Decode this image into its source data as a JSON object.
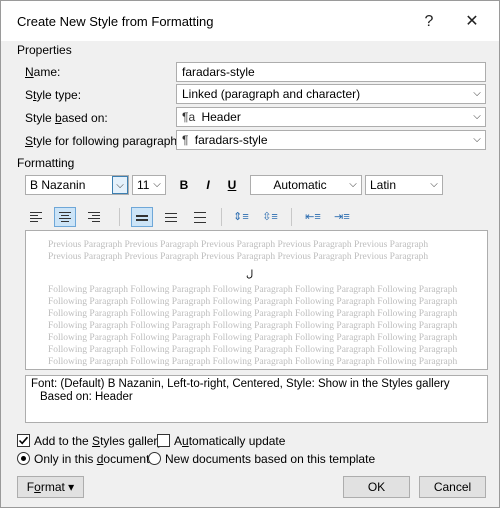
{
  "window": {
    "title": "Create New Style from Formatting",
    "help": "?",
    "close": "✕"
  },
  "properties": {
    "section_label": "Properties",
    "name_label_u": "N",
    "name_label_rest": "ame:",
    "name_value": "faradars-style",
    "type_label_pre": "S",
    "type_label_u": "t",
    "type_label_rest": "yle type:",
    "type_value": "Linked (paragraph and character)",
    "based_label_pre": "Style ",
    "based_label_u": "b",
    "based_label_rest": "ased on:",
    "based_icon": "¶a",
    "based_value": "Header",
    "following_label_u": "S",
    "following_label_rest": "tyle for following paragraph:",
    "following_icon": "¶",
    "following_value": "faradars-style"
  },
  "formatting": {
    "section_label": "Formatting",
    "font": "B Nazanin",
    "size": "11",
    "bold": "B",
    "italic": "I",
    "underline": "U",
    "color": "Automatic",
    "script": "Latin"
  },
  "preview": {
    "previous_text": "Previous Paragraph Previous Paragraph Previous Paragraph Previous Paragraph Previous Paragraph Previous Paragraph Previous Paragraph Previous Paragraph Previous Paragraph Previous Paragraph",
    "current_text": "ل",
    "following_lines": [
      "Following Paragraph Following Paragraph Following Paragraph Following Paragraph Following Paragraph",
      "Following Paragraph Following Paragraph Following Paragraph Following Paragraph Following Paragraph",
      "Following Paragraph Following Paragraph Following Paragraph Following Paragraph Following Paragraph",
      "Following Paragraph Following Paragraph Following Paragraph Following Paragraph Following Paragraph",
      "Following Paragraph Following Paragraph Following Paragraph Following Paragraph Following Paragraph",
      "Following Paragraph Following Paragraph Following Paragraph Following Paragraph Following Paragraph",
      "Following Paragraph Following Paragraph Following Paragraph Following Paragraph Following Paragraph"
    ]
  },
  "description": {
    "line1": "Font: (Default) B Nazanin, Left-to-right, Centered, Style: Show in the Styles gallery",
    "line2": "Based on: Header"
  },
  "options": {
    "add_to_gallery_pre": "Add to the ",
    "add_to_gallery_u": "S",
    "add_to_gallery_rest": "tyles gallery",
    "add_to_gallery_checked": true,
    "auto_update_pre": "A",
    "auto_update_u": "u",
    "auto_update_rest": "tomatically update",
    "auto_update_checked": false,
    "only_doc_pre": "Only in this ",
    "only_doc_u": "d",
    "only_doc_rest": "ocument",
    "new_docs_label": "New documents based on this template"
  },
  "buttons": {
    "format_u": "o",
    "format_pre": "F",
    "format_rest": "rmat",
    "format_arrow": "▾",
    "ok": "OK",
    "cancel": "Cancel"
  }
}
